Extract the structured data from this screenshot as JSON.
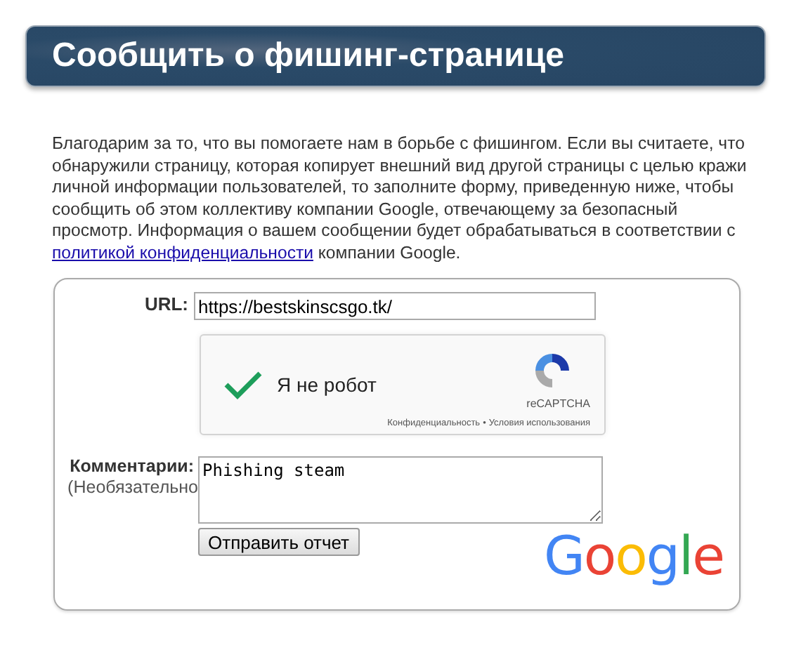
{
  "header": {
    "title": "Сообщить о фишинг-странице"
  },
  "intro": {
    "text_before": "Благодарим за то, что вы помогаете нам в борьбе с фишингом. Если вы считаете, что обнаружили страницу, которая копирует внешний вид другой страницы с целью кражи личной информации пользователей, то заполните форму, приведенную ниже, чтобы сообщить об этом коллективу компании Google, отвечающему за безопасный просмотр. Информация о вашем сообщении будет обрабатываться в соответствии с",
    "link": "политикой конфиденциальности",
    "text_after": "компании Google."
  },
  "form": {
    "url_label": "URL:",
    "url_value": "https://bestskinscsgo.tk/",
    "captcha": {
      "checked": true,
      "label": "Я не робот",
      "brand": "reCAPTCHA",
      "privacy": "Конфиденциальность",
      "separator": "•",
      "terms": "Условия использования"
    },
    "comment_label": "Комментарии:",
    "comment_hint": "(Необязательно",
    "comment_value": "Phishing steam",
    "submit": "Отправить отчет",
    "logo": "Google"
  }
}
